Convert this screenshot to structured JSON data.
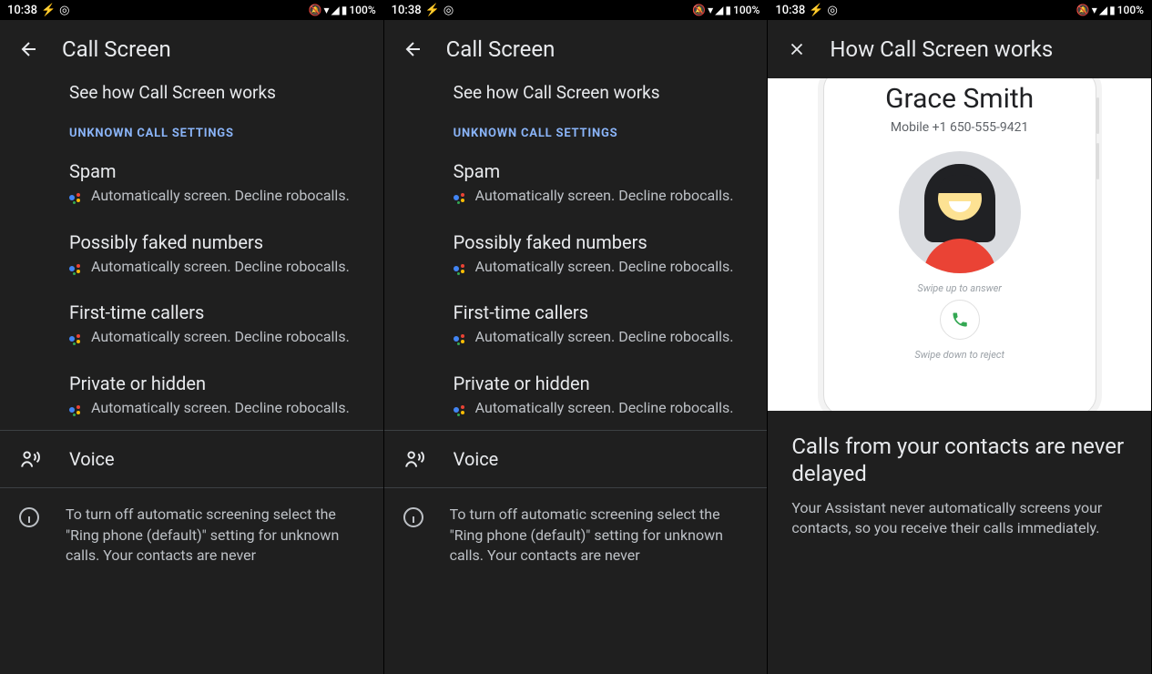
{
  "status": {
    "time": "10:38",
    "battery_pct": "100%"
  },
  "settings": {
    "title": "Call Screen",
    "how_link": "See how Call Screen works",
    "section": "Unknown Call Settings",
    "auto_desc": "Automatically screen. Decline robocalls.",
    "items": [
      {
        "title": "Spam"
      },
      {
        "title": "Possibly faked numbers"
      },
      {
        "title": "First-time callers"
      },
      {
        "title": "Private or hidden"
      }
    ],
    "voice": "Voice",
    "info_text": "To turn off automatic screening select the \"Ring phone (default)\" setting for unknown calls. Your contacts are never"
  },
  "howitworks": {
    "title": "How Call Screen works",
    "caller_name": "Grace Smith",
    "caller_num": "Mobile +1 650-555-9421",
    "swipe_up": "Swipe up to answer",
    "swipe_down": "Swipe down to reject",
    "headline": "Calls from your contacts are never delayed",
    "body": "Your Assistant never automatically screens your contacts, so you receive their calls immediately."
  }
}
